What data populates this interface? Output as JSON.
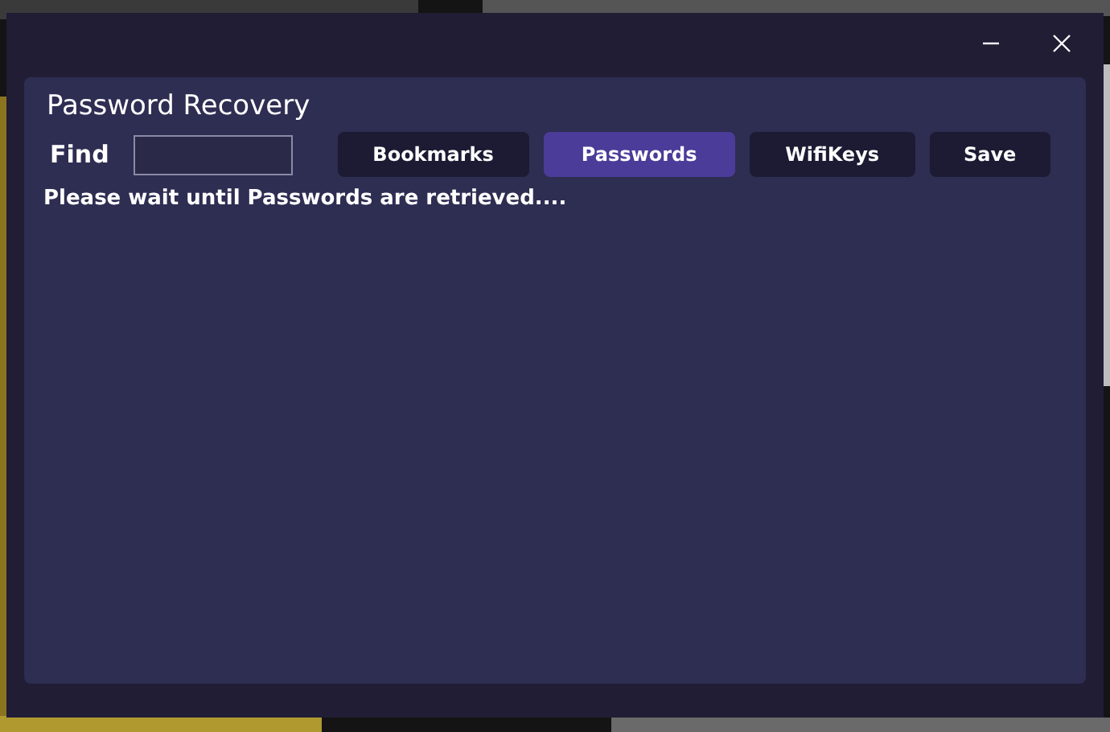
{
  "window": {
    "title": "Password Recovery"
  },
  "find": {
    "label": "Find"
  },
  "tabs": [
    {
      "label": "Bookmarks",
      "selected": false
    },
    {
      "label": "Passwords",
      "selected": true
    },
    {
      "label": "WifiKeys",
      "selected": false
    }
  ],
  "buttons": [
    "Save"
  ],
  "status": "Please wait until Passwords are retrieved...."
}
